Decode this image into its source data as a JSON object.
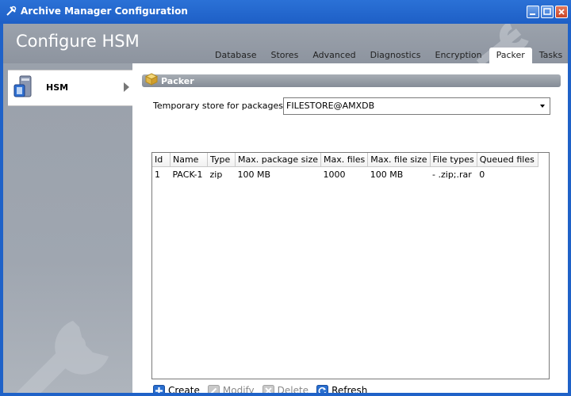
{
  "window": {
    "title": "Archive Manager Configuration",
    "controls": [
      "minimize",
      "maximize",
      "close"
    ]
  },
  "header": {
    "page_title": "Configure HSM",
    "tabs": [
      {
        "label": "Database",
        "active": false
      },
      {
        "label": "Stores",
        "active": false
      },
      {
        "label": "Advanced",
        "active": false
      },
      {
        "label": "Diagnostics",
        "active": false
      },
      {
        "label": "Encryption",
        "active": false
      },
      {
        "label": "Packer",
        "active": true
      },
      {
        "label": "Tasks",
        "active": false
      }
    ]
  },
  "sidebar": {
    "items": [
      {
        "label": "HSM",
        "icon": "hsm-server-icon"
      }
    ]
  },
  "section": {
    "title": "Packer",
    "icon": "package-icon"
  },
  "store": {
    "label": "Temporary store for packages:",
    "value": "FILESTORE@AMXDB"
  },
  "grid": {
    "columns": [
      "Id",
      "Name",
      "Type",
      "Max. package size",
      "Max. files",
      "Max. file size",
      "File types",
      "Queued files"
    ],
    "rows": [
      [
        "1",
        "PACK-1",
        "zip",
        "100 MB",
        "1000",
        "100 MB",
        "- .zip;.rar",
        "0"
      ]
    ]
  },
  "toolbar": {
    "create": "Create",
    "modify": "Modify",
    "delete": "Delete",
    "refresh": "Refresh"
  },
  "colors": {
    "titlebar": "#1e5fc6",
    "accent_blue": "#2a6fd0",
    "panel_gray": "#9aa1ab"
  }
}
